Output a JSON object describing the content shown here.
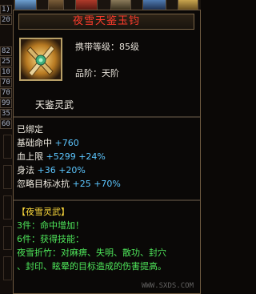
{
  "left_panel": {
    "numbers": [
      "1)",
      "20",
      "82",
      "25",
      "10",
      "70",
      "70",
      "99",
      "35",
      "60"
    ]
  },
  "tooltip": {
    "title": "夜雪天鉴玉钧",
    "carry_level_label": "携带等级：85级",
    "grade_label": "品阶：天阶",
    "set_name": "天鉴灵武",
    "bound_status": "已绑定",
    "stats": [
      {
        "name": "基础命中",
        "base": "+760",
        "bonus": ""
      },
      {
        "name": "血上限",
        "base": "+5299",
        "bonus": "+24%"
      },
      {
        "name": "身法",
        "base": "+36",
        "bonus": "+20%"
      },
      {
        "name": "忽略目标冰抗",
        "base": "+25",
        "bonus": "+70%"
      }
    ],
    "set_section": {
      "header": "【夜雪灵武】",
      "bonus3": "3件：命中增加！",
      "bonus6": "6件：获得技能：",
      "skill_line1": "夜雪折竹：对麻痹、失明、散功、封穴",
      "skill_line2": "、封印、眩晕的目标造成的伤害提高。"
    }
  },
  "watermark": "WWW.SXDS.COM",
  "colors": {
    "title_red": "#ff3c2c",
    "stat_blue": "#5cc6ff",
    "set_yellow": "#ffdc3c",
    "set_green": "#4ee65a",
    "frame_gold": "#b8a068"
  }
}
